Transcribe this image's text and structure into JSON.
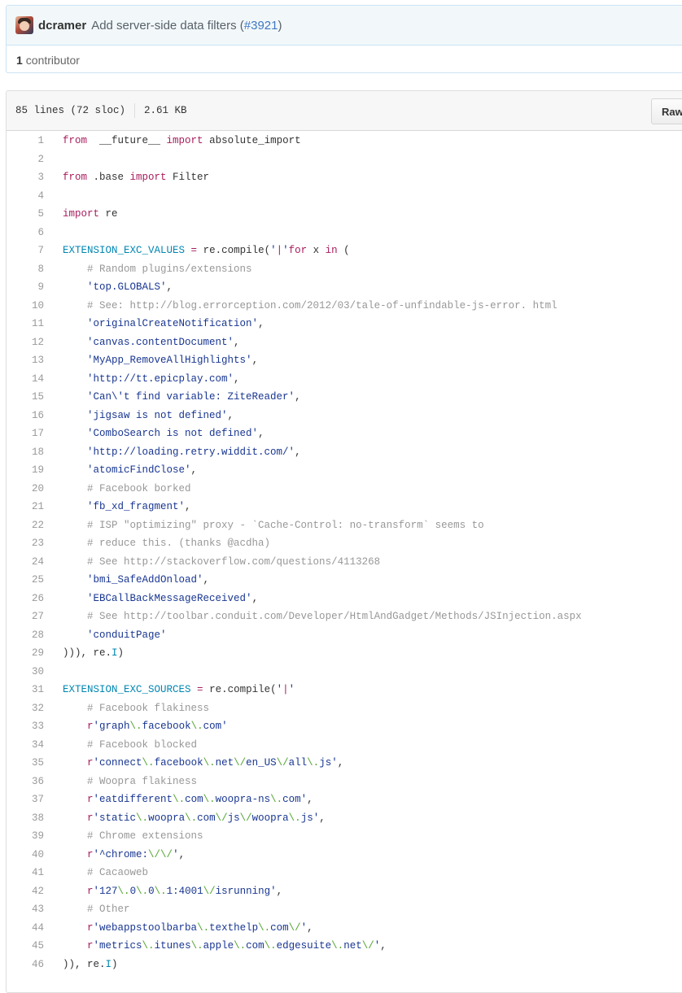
{
  "commit": {
    "author": "dcramer",
    "message": "Add server-side data filters (",
    "pr_number": "#3921",
    "message_end": ")"
  },
  "contributors": {
    "count": "1",
    "label": "contributor"
  },
  "file_info": {
    "lines": "85 lines (72 sloc)",
    "size": "2.61 KB",
    "raw_label": "Raw"
  },
  "colors": {
    "keyword": "#a71d5d",
    "constant": "#0086b3",
    "string": "#183691",
    "comment": "#969896",
    "escape": "#55a532",
    "link": "#4078c0"
  },
  "code_lines": [
    {
      "n": "1",
      "t": [
        [
          "kw",
          "from"
        ],
        [
          "",
          "  __future__ "
        ],
        [
          "kw",
          "import"
        ],
        [
          "",
          " absolute_import"
        ]
      ]
    },
    {
      "n": "2",
      "t": []
    },
    {
      "n": "3",
      "t": [
        [
          "kw",
          "from"
        ],
        [
          "",
          " .base "
        ],
        [
          "kw",
          "import"
        ],
        [
          "",
          " Filter"
        ]
      ]
    },
    {
      "n": "4",
      "t": []
    },
    {
      "n": "5",
      "t": [
        [
          "kw",
          "import"
        ],
        [
          "",
          " re"
        ]
      ]
    },
    {
      "n": "6",
      "t": []
    },
    {
      "n": "7",
      "t": [
        [
          "const",
          "EXTENSION_EXC_VALUES"
        ],
        [
          "",
          " "
        ],
        [
          "kw",
          "="
        ],
        [
          "",
          " re.compile("
        ],
        [
          "str",
          "'"
        ],
        [
          "kw",
          "|"
        ],
        [
          "str",
          "'"
        ],
        [
          ".join((re.escape(x) "
        ],
        [
          "kw",
          "for"
        ],
        [
          "",
          " x "
        ],
        [
          "kw",
          "in"
        ],
        [
          "",
          " ("
        ]
      ]
    },
    {
      "n": "8",
      "t": [
        [
          "",
          "    "
        ],
        [
          "cm",
          "# Random plugins/extensions"
        ]
      ]
    },
    {
      "n": "9",
      "t": [
        [
          "",
          "    "
        ],
        [
          "str",
          "'top.GLOBALS'"
        ],
        [
          "",
          ","
        ]
      ]
    },
    {
      "n": "10",
      "t": [
        [
          "",
          "    "
        ],
        [
          "cm",
          "# See: http://blog.errorception.com/2012/03/tale-of-unfindable-js-error. html"
        ]
      ]
    },
    {
      "n": "11",
      "t": [
        [
          "",
          "    "
        ],
        [
          "str",
          "'originalCreateNotification'"
        ],
        [
          "",
          ","
        ]
      ]
    },
    {
      "n": "12",
      "t": [
        [
          "",
          "    "
        ],
        [
          "str",
          "'canvas.contentDocument'"
        ],
        [
          "",
          ","
        ]
      ]
    },
    {
      "n": "13",
      "t": [
        [
          "",
          "    "
        ],
        [
          "str",
          "'MyApp_RemoveAllHighlights'"
        ],
        [
          "",
          ","
        ]
      ]
    },
    {
      "n": "14",
      "t": [
        [
          "",
          "    "
        ],
        [
          "str",
          "'http://tt.epicplay.com'"
        ],
        [
          "",
          ","
        ]
      ]
    },
    {
      "n": "15",
      "t": [
        [
          "",
          "    "
        ],
        [
          "str",
          "'Can\\'t find variable: ZiteReader'"
        ],
        [
          "",
          ","
        ]
      ]
    },
    {
      "n": "16",
      "t": [
        [
          "",
          "    "
        ],
        [
          "str",
          "'jigsaw is not defined'"
        ],
        [
          "",
          ","
        ]
      ]
    },
    {
      "n": "17",
      "t": [
        [
          "",
          "    "
        ],
        [
          "str",
          "'ComboSearch is not defined'"
        ],
        [
          "",
          ","
        ]
      ]
    },
    {
      "n": "18",
      "t": [
        [
          "",
          "    "
        ],
        [
          "str",
          "'http://loading.retry.widdit.com/'"
        ],
        [
          "",
          ","
        ]
      ]
    },
    {
      "n": "19",
      "t": [
        [
          "",
          "    "
        ],
        [
          "str",
          "'atomicFindClose'"
        ],
        [
          "",
          ","
        ]
      ]
    },
    {
      "n": "20",
      "t": [
        [
          "",
          "    "
        ],
        [
          "cm",
          "# Facebook borked"
        ]
      ]
    },
    {
      "n": "21",
      "t": [
        [
          "",
          "    "
        ],
        [
          "str",
          "'fb_xd_fragment'"
        ],
        [
          "",
          ","
        ]
      ]
    },
    {
      "n": "22",
      "t": [
        [
          "",
          "    "
        ],
        [
          "cm",
          "# ISP \"optimizing\" proxy - `Cache-Control: no-transform` seems to"
        ]
      ]
    },
    {
      "n": "23",
      "t": [
        [
          "",
          "    "
        ],
        [
          "cm",
          "# reduce this. (thanks @acdha)"
        ]
      ]
    },
    {
      "n": "24",
      "t": [
        [
          "",
          "    "
        ],
        [
          "cm",
          "# See http://stackoverflow.com/questions/4113268"
        ]
      ]
    },
    {
      "n": "25",
      "t": [
        [
          "",
          "    "
        ],
        [
          "str",
          "'bmi_SafeAddOnload'"
        ],
        [
          "",
          ","
        ]
      ]
    },
    {
      "n": "26",
      "t": [
        [
          "",
          "    "
        ],
        [
          "str",
          "'EBCallBackMessageReceived'"
        ],
        [
          "",
          ","
        ]
      ]
    },
    {
      "n": "27",
      "t": [
        [
          "",
          "    "
        ],
        [
          "cm",
          "# See http://toolbar.conduit.com/Developer/HtmlAndGadget/Methods/JSInjection.aspx"
        ]
      ]
    },
    {
      "n": "28",
      "t": [
        [
          "",
          "    "
        ],
        [
          "str",
          "'conduitPage'"
        ]
      ]
    },
    {
      "n": "29",
      "t": [
        [
          "",
          ")))"
        ],
        [
          "",
          ", re."
        ],
        [
          "const",
          "I"
        ],
        [
          "",
          ")"
        ]
      ]
    },
    {
      "n": "30",
      "t": []
    },
    {
      "n": "31",
      "t": [
        [
          "const",
          "EXTENSION_EXC_SOURCES"
        ],
        [
          "",
          " "
        ],
        [
          "kw",
          "="
        ],
        [
          "",
          " re.compile("
        ],
        [
          "str",
          "'"
        ],
        [
          "kw",
          "|"
        ],
        [
          "str",
          "'"
        ],
        [
          ".join(("
        ]
      ]
    },
    {
      "n": "32",
      "t": [
        [
          "",
          "    "
        ],
        [
          "cm",
          "# Facebook flakiness"
        ]
      ]
    },
    {
      "n": "33",
      "t": [
        [
          "",
          "    "
        ],
        [
          "kw",
          "r"
        ],
        [
          "str",
          "'graph"
        ],
        [
          "esc",
          "\\."
        ],
        [
          "str",
          "facebook"
        ],
        [
          "esc",
          "\\."
        ],
        [
          "str",
          "com'"
        ]
      ]
    },
    {
      "n": "34",
      "t": [
        [
          "",
          "    "
        ],
        [
          "cm",
          "# Facebook blocked"
        ]
      ]
    },
    {
      "n": "35",
      "t": [
        [
          "",
          "    "
        ],
        [
          "kw",
          "r"
        ],
        [
          "str",
          "'connect"
        ],
        [
          "esc",
          "\\."
        ],
        [
          "str",
          "facebook"
        ],
        [
          "esc",
          "\\."
        ],
        [
          "str",
          "net"
        ],
        [
          "esc",
          "\\/"
        ],
        [
          "str",
          "en_US"
        ],
        [
          "esc",
          "\\/"
        ],
        [
          "str",
          "all"
        ],
        [
          "esc",
          "\\."
        ],
        [
          "str",
          "js'"
        ],
        [
          "",
          ","
        ]
      ]
    },
    {
      "n": "36",
      "t": [
        [
          "",
          "    "
        ],
        [
          "cm",
          "# Woopra flakiness"
        ]
      ]
    },
    {
      "n": "37",
      "t": [
        [
          "",
          "    "
        ],
        [
          "kw",
          "r"
        ],
        [
          "str",
          "'eatdifferent"
        ],
        [
          "esc",
          "\\."
        ],
        [
          "str",
          "com"
        ],
        [
          "esc",
          "\\."
        ],
        [
          "str",
          "woopra-ns"
        ],
        [
          "esc",
          "\\."
        ],
        [
          "str",
          "com'"
        ],
        [
          "",
          ","
        ]
      ]
    },
    {
      "n": "38",
      "t": [
        [
          "",
          "    "
        ],
        [
          "kw",
          "r"
        ],
        [
          "str",
          "'static"
        ],
        [
          "esc",
          "\\."
        ],
        [
          "str",
          "woopra"
        ],
        [
          "esc",
          "\\."
        ],
        [
          "str",
          "com"
        ],
        [
          "esc",
          "\\/"
        ],
        [
          "str",
          "js"
        ],
        [
          "esc",
          "\\/"
        ],
        [
          "str",
          "woopra"
        ],
        [
          "esc",
          "\\."
        ],
        [
          "str",
          "js'"
        ],
        [
          "",
          ","
        ]
      ]
    },
    {
      "n": "39",
      "t": [
        [
          "",
          "    "
        ],
        [
          "cm",
          "# Chrome extensions"
        ]
      ]
    },
    {
      "n": "40",
      "t": [
        [
          "",
          "    "
        ],
        [
          "kw",
          "r"
        ],
        [
          "str",
          "'^chrome:"
        ],
        [
          "esc",
          "\\/\\/"
        ],
        [
          "str",
          "'"
        ],
        [
          "",
          ","
        ]
      ]
    },
    {
      "n": "41",
      "t": [
        [
          "",
          "    "
        ],
        [
          "cm",
          "# Cacaoweb"
        ]
      ]
    },
    {
      "n": "42",
      "t": [
        [
          "",
          "    "
        ],
        [
          "kw",
          "r"
        ],
        [
          "str",
          "'127"
        ],
        [
          "esc",
          "\\."
        ],
        [
          "str",
          "0"
        ],
        [
          "esc",
          "\\."
        ],
        [
          "str",
          "0"
        ],
        [
          "esc",
          "\\."
        ],
        [
          "str",
          "1:4001"
        ],
        [
          "esc",
          "\\/"
        ],
        [
          "str",
          "isrunning'"
        ],
        [
          "",
          ","
        ]
      ]
    },
    {
      "n": "43",
      "t": [
        [
          "",
          "    "
        ],
        [
          "cm",
          "# Other"
        ]
      ]
    },
    {
      "n": "44",
      "t": [
        [
          "",
          "    "
        ],
        [
          "kw",
          "r"
        ],
        [
          "str",
          "'webappstoolbarba"
        ],
        [
          "esc",
          "\\."
        ],
        [
          "str",
          "texthelp"
        ],
        [
          "esc",
          "\\."
        ],
        [
          "str",
          "com"
        ],
        [
          "esc",
          "\\/"
        ],
        [
          "str",
          "'"
        ],
        [
          "",
          ","
        ]
      ]
    },
    {
      "n": "45",
      "t": [
        [
          "",
          "    "
        ],
        [
          "kw",
          "r"
        ],
        [
          "str",
          "'metrics"
        ],
        [
          "esc",
          "\\."
        ],
        [
          "str",
          "itunes"
        ],
        [
          "esc",
          "\\."
        ],
        [
          "str",
          "apple"
        ],
        [
          "esc",
          "\\."
        ],
        [
          "str",
          "com"
        ],
        [
          "esc",
          "\\."
        ],
        [
          "str",
          "edgesuite"
        ],
        [
          "esc",
          "\\."
        ],
        [
          "str",
          "net"
        ],
        [
          "esc",
          "\\/"
        ],
        [
          "str",
          "'"
        ],
        [
          "",
          ","
        ]
      ]
    },
    {
      "n": "46",
      "t": [
        [
          "",
          "))"
        ],
        [
          "",
          ", re."
        ],
        [
          "const",
          "I"
        ],
        [
          "",
          ")"
        ]
      ]
    }
  ]
}
